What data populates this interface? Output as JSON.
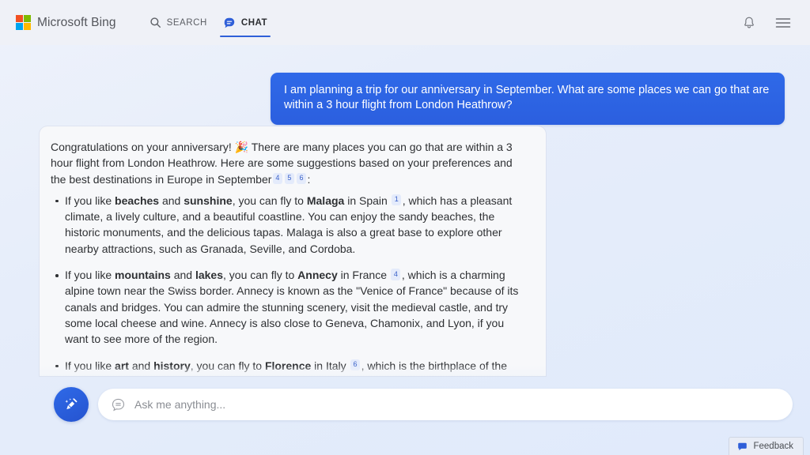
{
  "header": {
    "brand": "Microsoft Bing",
    "logo_icon": "microsoft-logo-icon",
    "tabs": [
      {
        "label": "SEARCH",
        "icon": "search-icon",
        "active": false
      },
      {
        "label": "CHAT",
        "icon": "chat-bubble-icon",
        "active": true
      }
    ],
    "notifications_icon": "bell-icon",
    "menu_icon": "hamburger-menu-icon"
  },
  "conversation": {
    "user_message": "I am planning a trip for our anniversary in September. What are some places we can go that are within a 3 hour flight from London Heathrow?",
    "response": {
      "intro_part1": "Congratulations on your anniversary! 🎉 There are many places you can go that are within a 3 hour flight from London Heathrow. Here are some suggestions based on your preferences and the best destinations in Europe in September",
      "intro_citations": [
        "4",
        "5",
        "6"
      ],
      "intro_suffix": ":",
      "bullets": [
        {
          "pre": "If you like ",
          "bold1": "beaches",
          "mid1": " and ",
          "bold2": "sunshine",
          "mid2": ", you can fly to ",
          "bold3": "Malaga",
          "mid3": " in Spain ",
          "citation": "1",
          "post": ", which has a pleasant climate, a lively culture, and a beautiful coastline. You can enjoy the sandy beaches, the historic monuments, and the delicious tapas. Malaga is also a great base to explore other nearby attractions, such as Granada, Seville, and Cordoba."
        },
        {
          "pre": "If you like ",
          "bold1": "mountains",
          "mid1": " and ",
          "bold2": "lakes",
          "mid2": ", you can fly to ",
          "bold3": "Annecy",
          "mid3": " in France ",
          "citation": "4",
          "post": ", which is a charming alpine town near the Swiss border. Annecy is known as the \"Venice of France\" because of its canals and bridges. You can admire the stunning scenery, visit the medieval castle, and try some local cheese and wine. Annecy is also close to Geneva, Chamonix, and Lyon, if you want to see more of the region."
        },
        {
          "pre": "If you like ",
          "bold1": "art",
          "mid1": " and ",
          "bold2": "history",
          "mid2": ", you can fly to ",
          "bold3": "Florence",
          "mid3": " in Italy ",
          "citation": "6",
          "post": ", which is the birthplace of the Renaissance and a UNESCO World Heritage Site. Florence is a treasure trove of artistic and architectural masterpieces, such as the Duomo, the Uffizi Gallery, and the Ponte Vecchio. You can also explore the Tuscan countryside, taste the famous gelato, and shop for leather goods."
        }
      ]
    }
  },
  "composer": {
    "new_topic_icon": "broom-sweep-icon",
    "tone_icon": "chat-lines-icon",
    "placeholder": "Ask me anything...",
    "value": ""
  },
  "feedback": {
    "label": "Feedback",
    "icon": "feedback-bubble-icon"
  },
  "colors": {
    "accent_blue": "#2f5fd8",
    "user_bubble": "#2b5fdf",
    "citation_bg": "#e4ebfb",
    "citation_text": "#3b62c9",
    "page_bg": "#e6edfa",
    "header_bg": "#eff1f7",
    "card_bg": "#f7f8fa"
  }
}
